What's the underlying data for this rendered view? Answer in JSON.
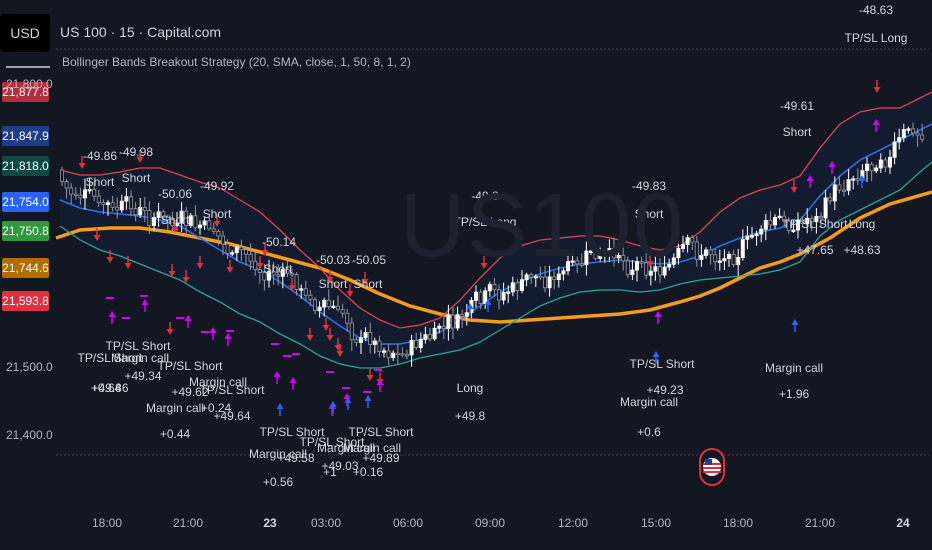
{
  "header": {
    "currency": "USD",
    "title": "US 100 · 15 · Capital.com",
    "indicator": "Bollinger Bands Breakout Strategy (20, SMA, close, 1, 50, 8, 1, 2)"
  },
  "watermark": "US100",
  "colors": {
    "background": "#131722",
    "upper_band": "#e04452",
    "basis": "#2e6ff0",
    "lower_band": "#26a69a",
    "sma": "#f59c1a",
    "short_arrow": "#e03040",
    "long_arrow": "#2962ff",
    "exit_arrow": "#d500f9"
  },
  "price_tags": [
    {
      "label": "21,877.8",
      "color": "#b03040",
      "value": 21877.8
    },
    {
      "label": "21,847.9",
      "color": "#1d3f8a",
      "value": 21847.9
    },
    {
      "label": "21,818.0",
      "color": "#0d4a45",
      "value": 21818.0
    },
    {
      "label": "21,754.0",
      "color": "#2962ff",
      "value": 21754.0
    },
    {
      "label": "21,750.8",
      "color": "#2e9a3d",
      "value": 21750.8
    },
    {
      "label": "21,744.6",
      "color": "#b36c00",
      "value": 21744.6
    },
    {
      "label": "21,593.8",
      "color": "#e03040",
      "value": 21593.8
    }
  ],
  "axis": {
    "price_ticks": [
      "21,800.0",
      "21,500.0",
      "21,400.0"
    ],
    "time_ticks": [
      "18:00",
      "21:00",
      "23",
      "03:00",
      "06:00",
      "09:00",
      "12:00",
      "15:00",
      "18:00",
      "21:00",
      "24"
    ]
  },
  "chart_data": {
    "type": "candlestick",
    "title": "US 100 · 15 · Capital.com",
    "y_range": [
      21360,
      21960
    ],
    "bands_note": "",
    "trade_labels": [
      {
        "text": "-49.86",
        "sub": "Short"
      },
      {
        "text": "-49.98",
        "sub": "Short"
      },
      {
        "text": "-50.06",
        "sub": "Short"
      },
      {
        "text": "-49.92",
        "sub": "Short"
      },
      {
        "text": "-50.14",
        "sub": "Short"
      },
      {
        "text": "-50.03",
        "sub": "Short"
      },
      {
        "text": "-50.05",
        "sub": "Short"
      },
      {
        "text": "-49.8",
        "sub": "TP/SL Long"
      },
      {
        "text": "-49.83",
        "sub": "Short"
      },
      {
        "text": "-49.61",
        "sub": "Short"
      },
      {
        "text": "-48.63",
        "sub": "TP/SL Long"
      },
      {
        "text": "TP/SL Short",
        "sub": "+47.65"
      },
      {
        "text": "Long",
        "sub": "+48.63"
      },
      {
        "text": "TP/SL Short",
        "sub": "+49.86"
      },
      {
        "text": "TP/SL Short",
        "sub": "+49.34"
      },
      {
        "text": "Margin call",
        "sub": "+0.64"
      },
      {
        "text": "TP/SL Short",
        "sub": "+49.62"
      },
      {
        "text": "Margin call",
        "sub": "+0.44"
      },
      {
        "text": "Margin call",
        "sub": "+0.24"
      },
      {
        "text": "TP/SL Short",
        "sub": "+49.64"
      },
      {
        "text": "TP/SL Short",
        "sub": "+49.58"
      },
      {
        "text": "Margin call",
        "sub": "+0.56"
      },
      {
        "text": "TP/SL Short",
        "sub": "+49.03"
      },
      {
        "text": "Margin call",
        "sub": "+1"
      },
      {
        "text": "TP/SL Short",
        "sub": "+49.89"
      },
      {
        "text": "Margin call",
        "sub": "+0.16"
      },
      {
        "text": "Long",
        "sub": "+49.8"
      },
      {
        "text": "TP/SL Short",
        "sub": "+49.23"
      },
      {
        "text": "Margin call",
        "sub": "+0.6"
      },
      {
        "text": "Margin call",
        "sub": "+1.96"
      }
    ]
  }
}
